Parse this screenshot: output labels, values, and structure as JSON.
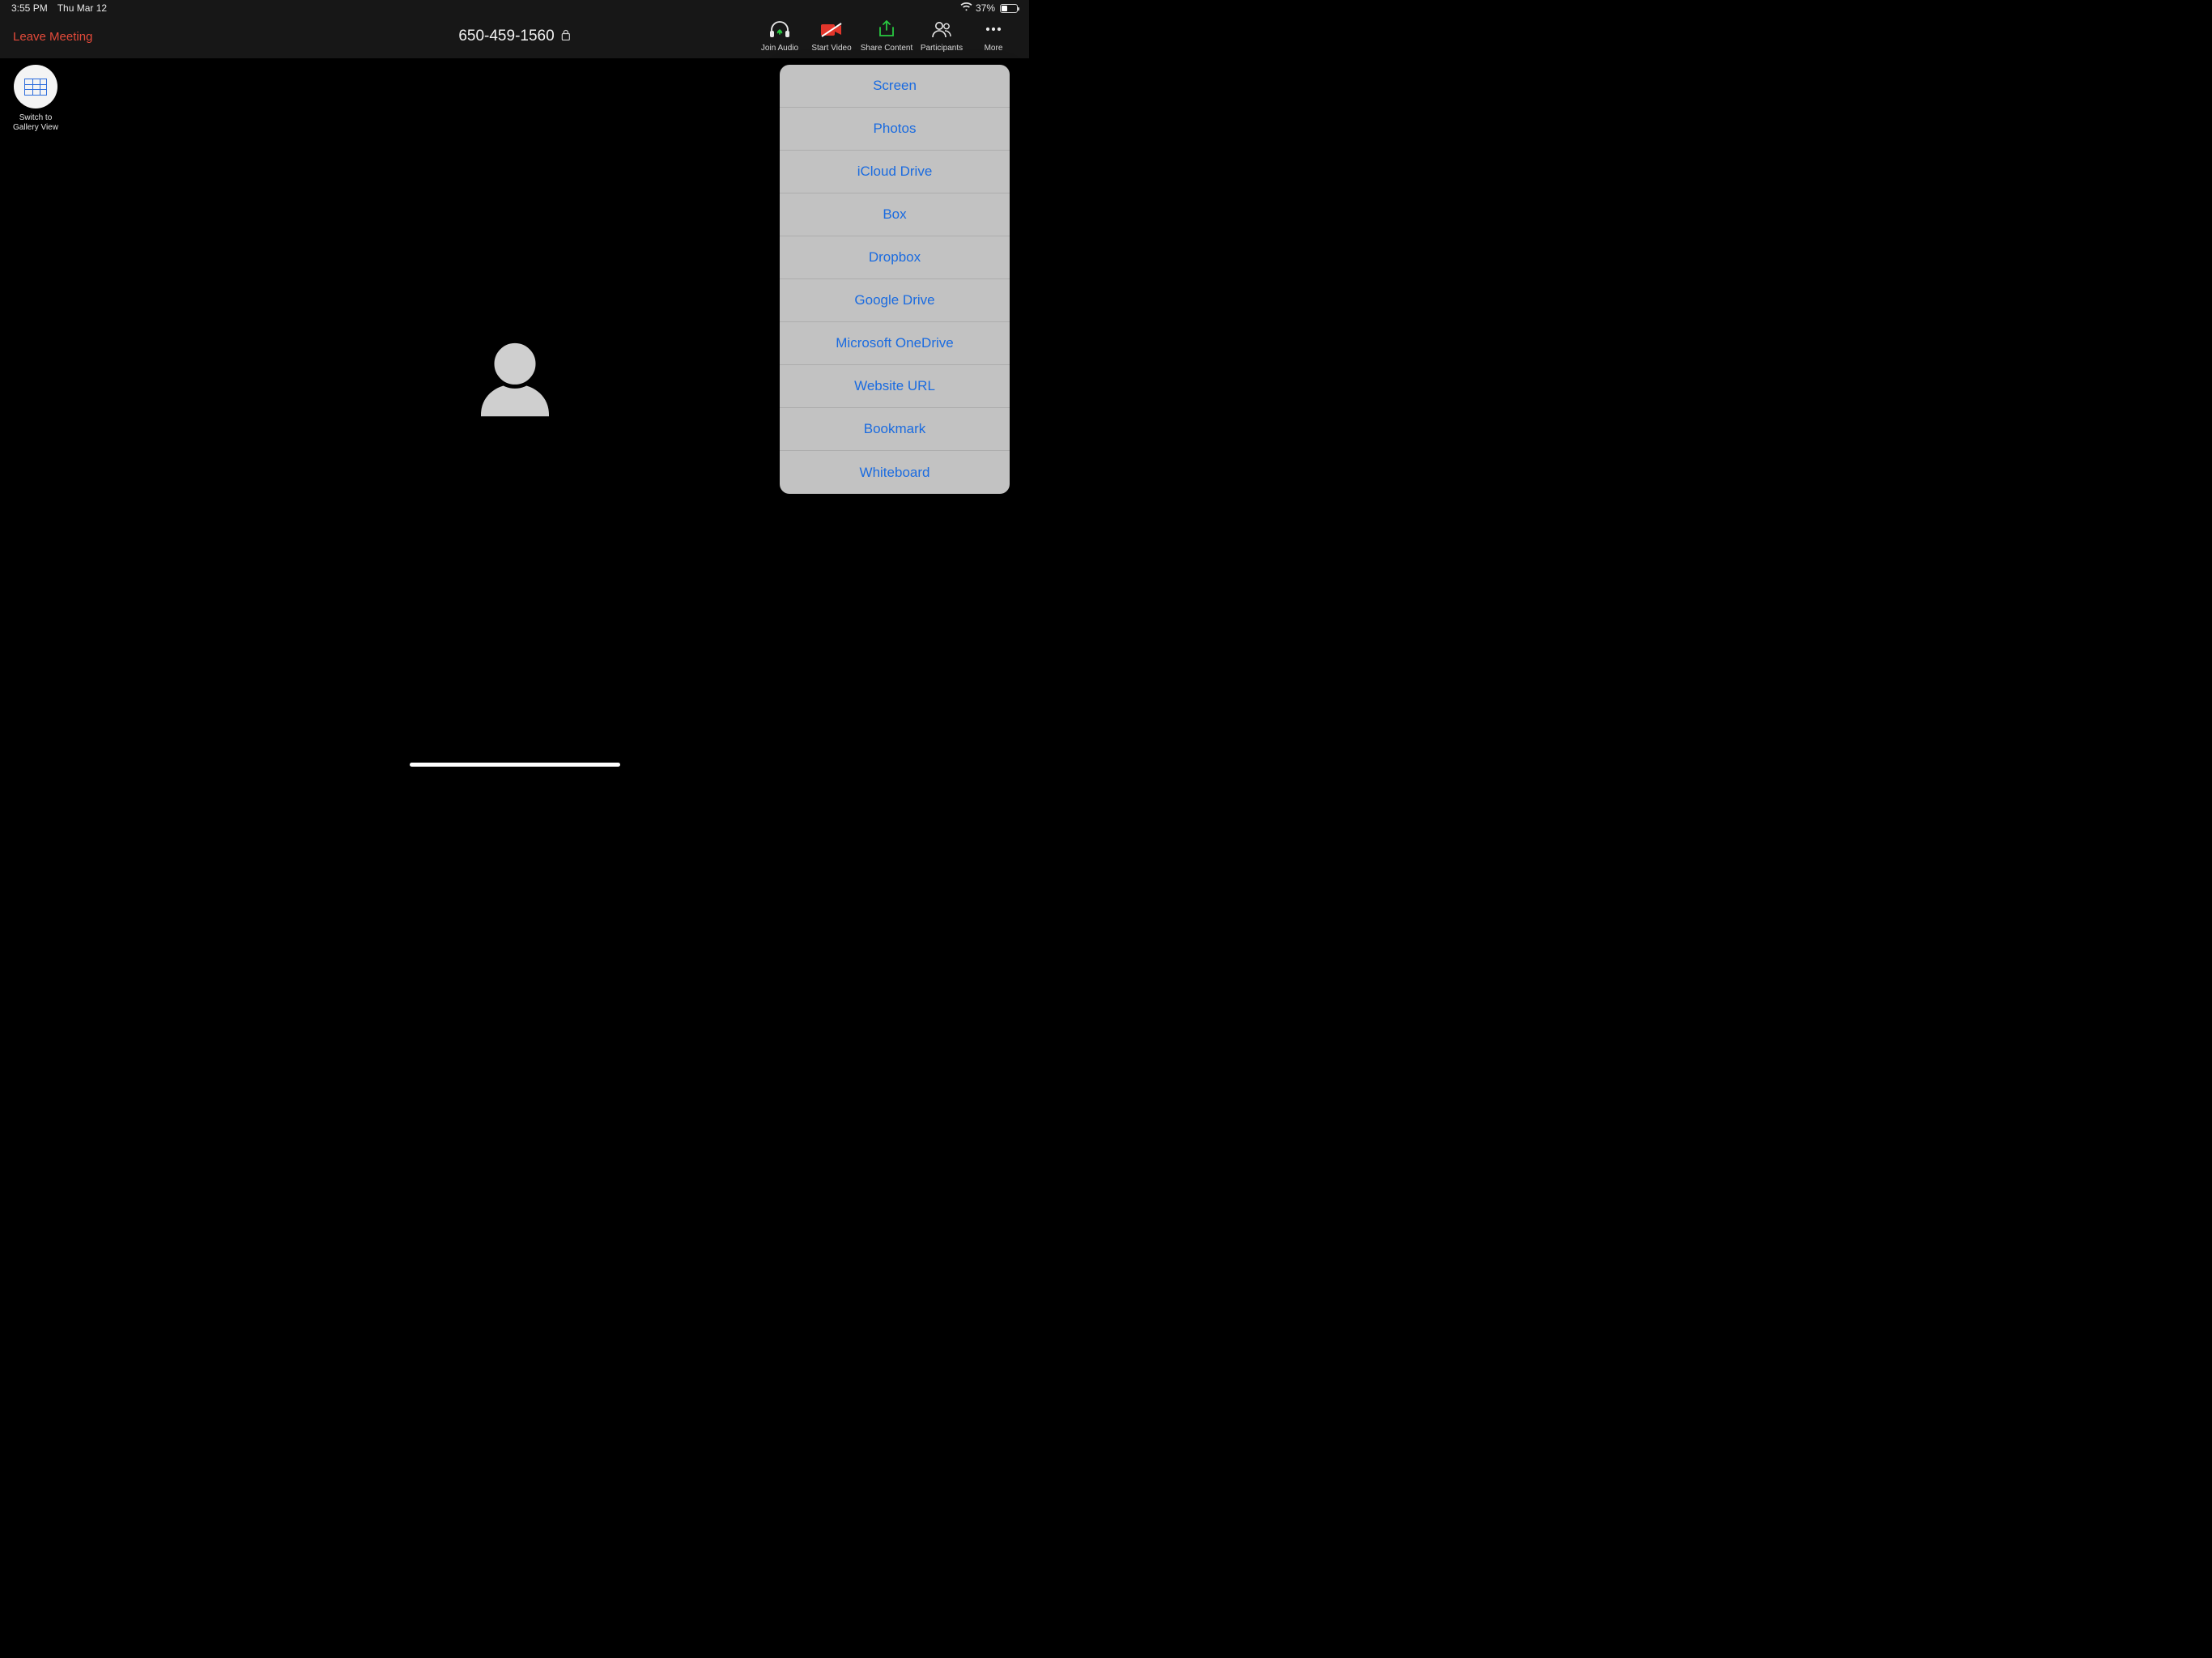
{
  "status": {
    "time": "3:55 PM",
    "date": "Thu Mar 12",
    "battery_pct": "37%"
  },
  "header": {
    "leave_label": "Leave Meeting",
    "meeting_title": "650-459-1560"
  },
  "toolbar": {
    "join_audio": "Join Audio",
    "start_video": "Start Video",
    "share_content": "Share Content",
    "participants": "Participants",
    "more": "More"
  },
  "gallery_toggle": {
    "line1": "Switch to",
    "line2": "Gallery View"
  },
  "share_menu": {
    "items": [
      "Screen",
      "Photos",
      "iCloud Drive",
      "Box",
      "Dropbox",
      "Google Drive",
      "Microsoft OneDrive",
      "Website URL",
      "Bookmark",
      "Whiteboard"
    ]
  },
  "colors": {
    "leave_red": "#e44a3a",
    "link_blue": "#1a6be0",
    "share_green": "#28c840",
    "video_red": "#e2362b"
  }
}
